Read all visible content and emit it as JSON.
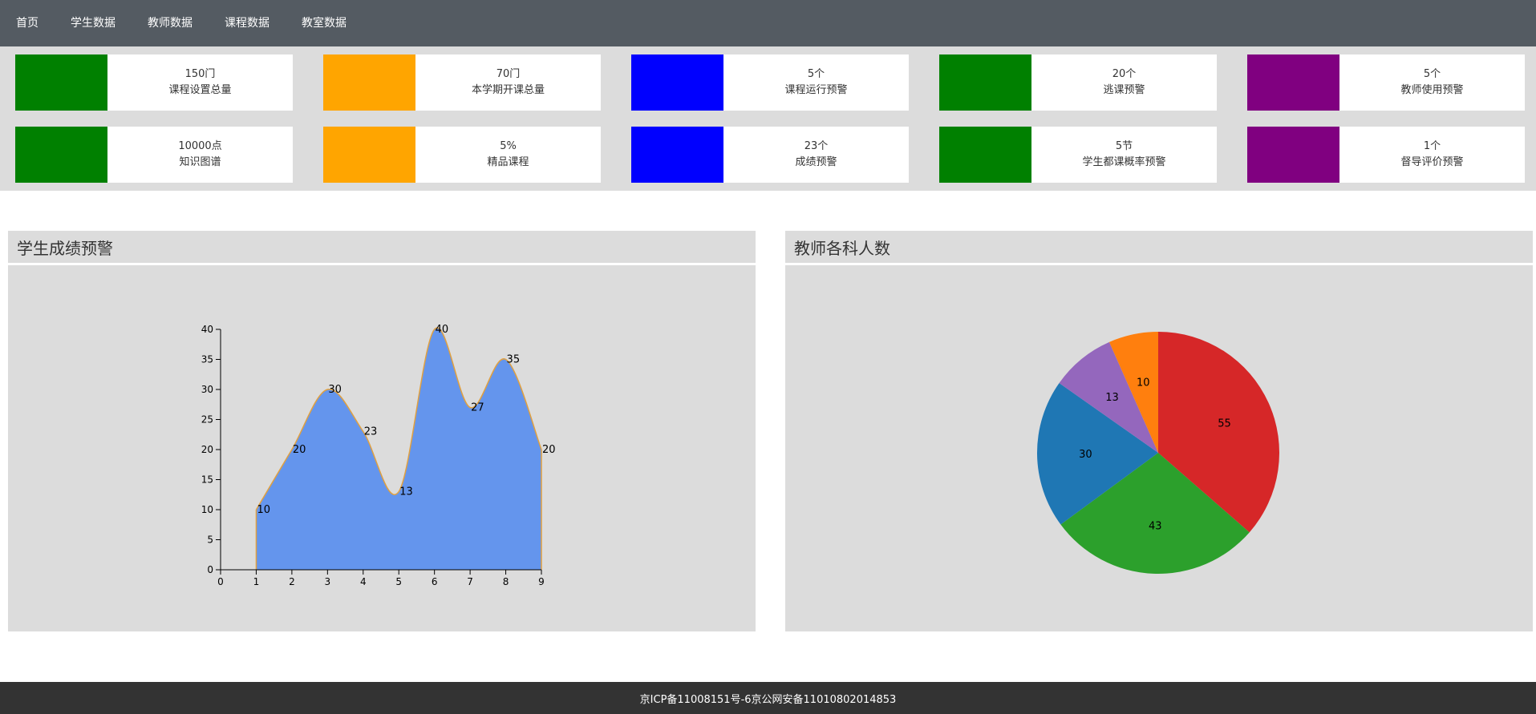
{
  "nav": {
    "items": [
      {
        "label": "首页"
      },
      {
        "label": "学生数据"
      },
      {
        "label": "教师数据"
      },
      {
        "label": "课程数据"
      },
      {
        "label": "教室数据"
      }
    ]
  },
  "stats": {
    "row1": [
      {
        "value": "150门",
        "label": "课程设置总量",
        "color": "#008000"
      },
      {
        "value": "70门",
        "label": "本学期开课总量",
        "color": "#ffa500"
      },
      {
        "value": "5个",
        "label": "课程运行预警",
        "color": "#0000ff"
      },
      {
        "value": "20个",
        "label": "逃课预警",
        "color": "#008000"
      },
      {
        "value": "5个",
        "label": "教师使用预警",
        "color": "#800080"
      }
    ],
    "row2": [
      {
        "value": "10000点",
        "label": "知识图谱",
        "color": "#008000"
      },
      {
        "value": "5%",
        "label": "精品课程",
        "color": "#ffa500"
      },
      {
        "value": "23个",
        "label": "成绩预警",
        "color": "#0000ff"
      },
      {
        "value": "5节",
        "label": "学生都课概率预警",
        "color": "#008000"
      },
      {
        "value": "1个",
        "label": "督导评价预警",
        "color": "#800080"
      }
    ]
  },
  "panels": {
    "left_title": "学生成绩预警",
    "right_title": "教师各科人数"
  },
  "chart_data": [
    {
      "type": "area",
      "title": "",
      "xlabel": "",
      "ylabel": "",
      "x": [
        1,
        2,
        3,
        4,
        5,
        6,
        7,
        8,
        9
      ],
      "values": [
        10,
        20,
        30,
        23,
        13,
        40,
        27,
        35,
        20
      ],
      "xlim": [
        0,
        9
      ],
      "ylim": [
        0,
        40
      ],
      "x_ticks": [
        0,
        1,
        2,
        3,
        4,
        5,
        6,
        7,
        8,
        9
      ],
      "y_ticks": [
        0,
        5,
        10,
        15,
        20,
        25,
        30,
        35,
        40
      ],
      "fill_color": "#6495ed",
      "line_color": "#e0a040",
      "grid": false
    },
    {
      "type": "pie",
      "title": "",
      "values": [
        55,
        43,
        30,
        13,
        10
      ],
      "colors": [
        "#d62728",
        "#2ca02c",
        "#1f77b4",
        "#9467bd",
        "#ff7f0e"
      ]
    }
  ],
  "footer": {
    "text": "京ICP备11008151号-6京公网安备11010802014853"
  }
}
